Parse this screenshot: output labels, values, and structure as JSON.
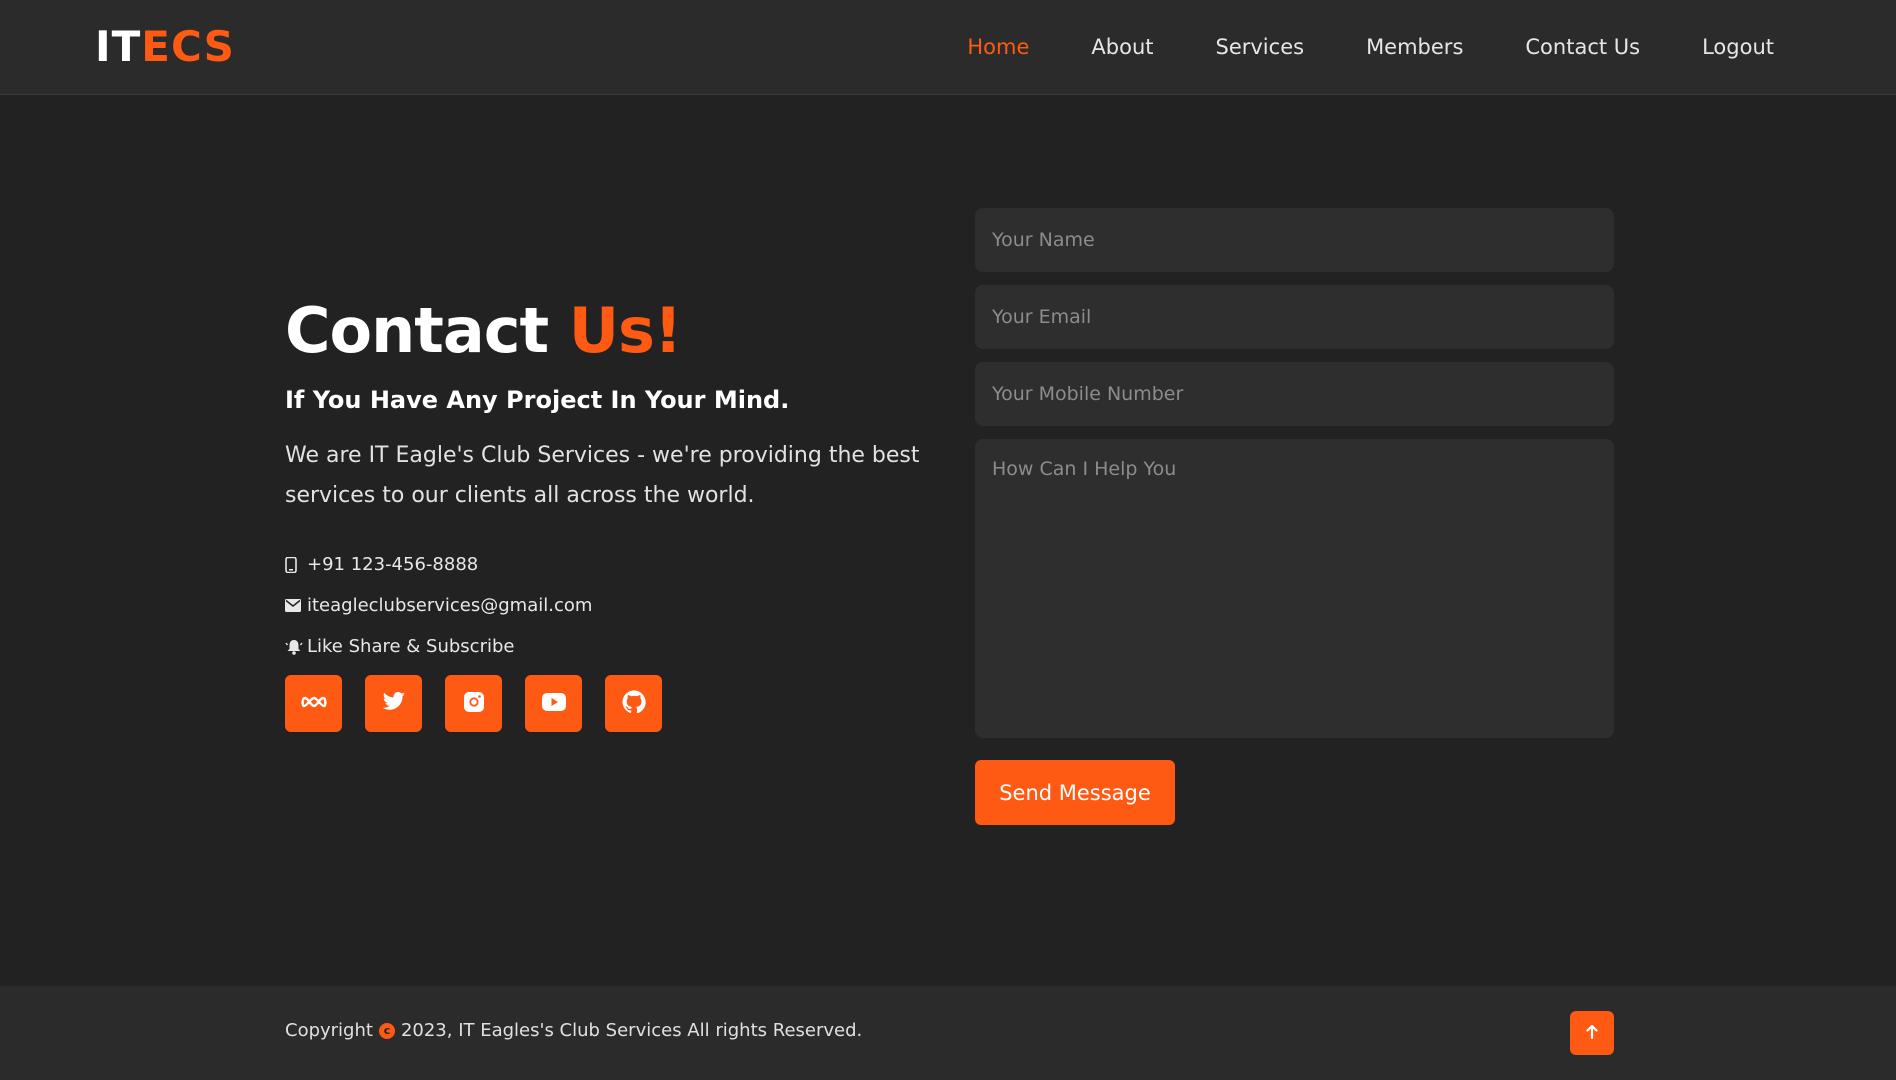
{
  "header": {
    "logo_part1": "IT",
    "logo_part2": "ECS",
    "nav": [
      {
        "label": "Home",
        "active": true
      },
      {
        "label": "About"
      },
      {
        "label": "Services"
      },
      {
        "label": "Members"
      },
      {
        "label": "Contact Us"
      },
      {
        "label": "Logout"
      }
    ]
  },
  "contact": {
    "title_part1": "Contact",
    "title_part2": "Us!",
    "subtitle": "If You Have Any Project In Your Mind.",
    "description": "We are IT Eagle's Club Services - we're providing the best services to our clients all across the world.",
    "phone": "+91 123-456-8888",
    "email": "iteagleclubservices@gmail.com",
    "social_text": "Like Share & Subscribe",
    "socials": [
      "meta-icon",
      "twitter-icon",
      "instagram-icon",
      "youtube-icon",
      "github-icon"
    ]
  },
  "form": {
    "name_placeholder": "Your Name",
    "email_placeholder": "Your Email",
    "mobile_placeholder": "Your Mobile Number",
    "message_placeholder": "How Can I Help You",
    "submit_label": "Send Message"
  },
  "footer": {
    "copy_prefix": "Copyright",
    "copy_text": "2023, IT Eagles's Club Services All rights Reserved."
  },
  "colors": {
    "accent": "#ff5a14",
    "background": "#222222",
    "header": "#2b2b2b",
    "field": "#2e2e2e"
  }
}
